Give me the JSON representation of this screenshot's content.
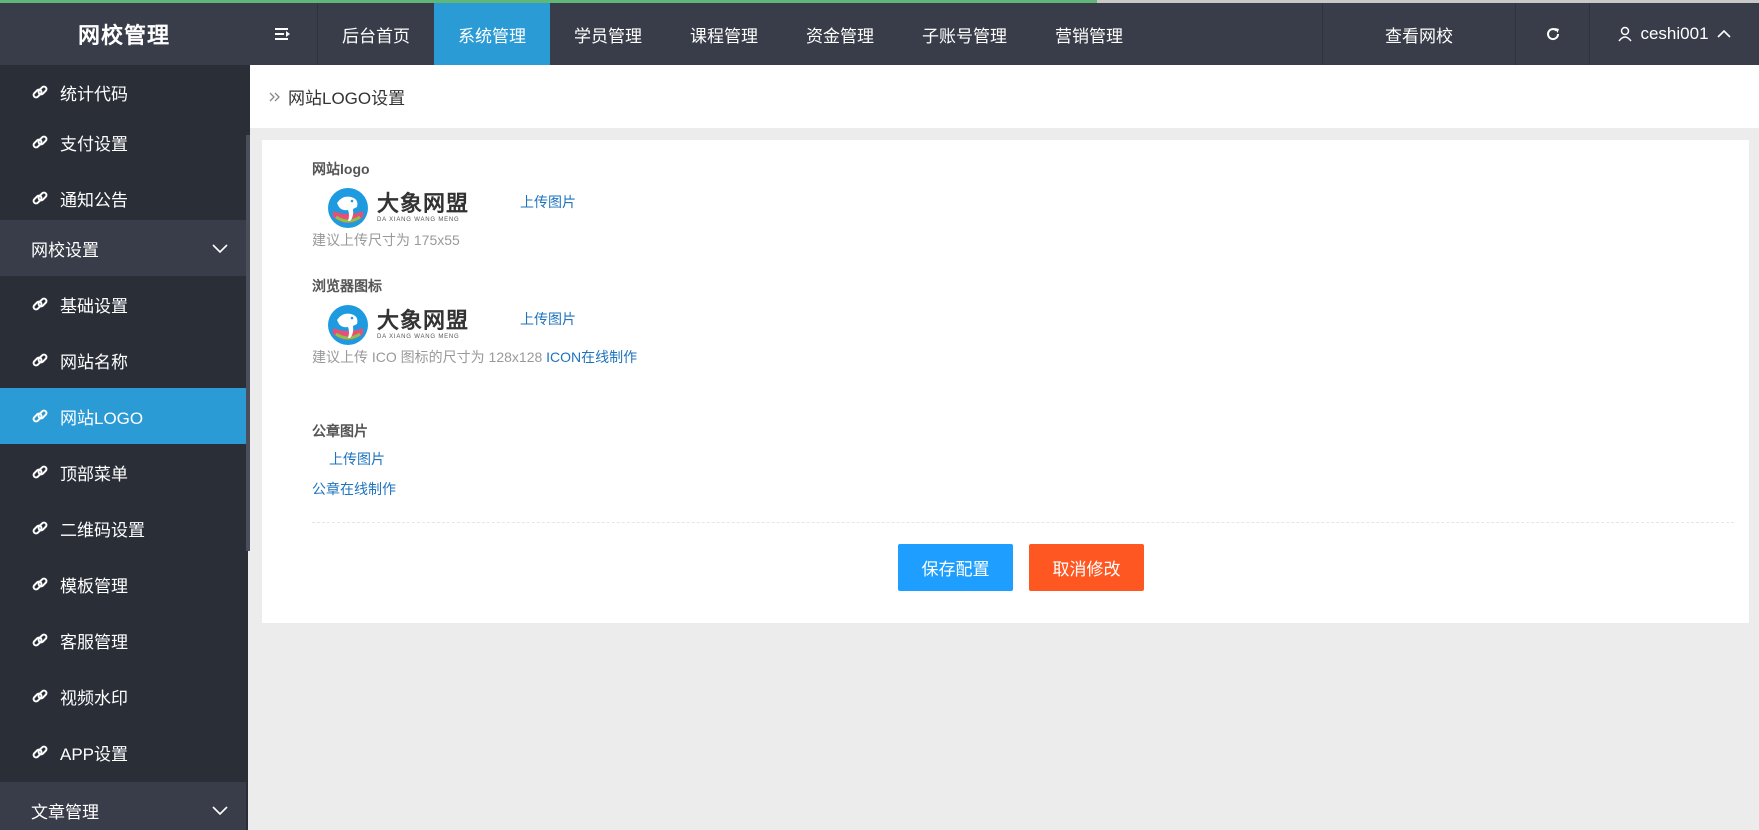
{
  "brand": {
    "title": "网校管理"
  },
  "topnav": {
    "items": [
      {
        "label": "后台首页",
        "active": false
      },
      {
        "label": "系统管理",
        "active": true
      },
      {
        "label": "学员管理",
        "active": false
      },
      {
        "label": "课程管理",
        "active": false
      },
      {
        "label": "资金管理",
        "active": false
      },
      {
        "label": "子账号管理",
        "active": false
      },
      {
        "label": "营销管理",
        "active": false
      }
    ],
    "view_site": "查看网校",
    "username": "ceshi001"
  },
  "sidebar": {
    "items": [
      {
        "label": "统计代码"
      },
      {
        "label": "支付设置"
      },
      {
        "label": "通知公告"
      }
    ],
    "group_school": "网校设置",
    "school_items": [
      {
        "label": "基础设置"
      },
      {
        "label": "网站名称"
      },
      {
        "label": "网站LOGO"
      },
      {
        "label": "顶部菜单"
      },
      {
        "label": "二维码设置"
      },
      {
        "label": "模板管理"
      },
      {
        "label": "客服管理"
      },
      {
        "label": "视频水印"
      },
      {
        "label": "APP设置"
      }
    ],
    "group_article": "文章管理"
  },
  "breadcrumb": {
    "current": "网站LOGO设置"
  },
  "form": {
    "logo": {
      "label": "网站logo",
      "brand_cn": "大象网盟",
      "brand_en": "DA XIANG WANG MENG",
      "upload": "上传图片",
      "hint": "建议上传尺寸为 175x55"
    },
    "favicon": {
      "label": "浏览器图标",
      "brand_cn": "大象网盟",
      "brand_en": "DA XIANG WANG MENG",
      "upload": "上传图片",
      "hint": "建议上传 ICO 图标的尺寸为 128x128",
      "hint_link": "ICON在线制作"
    },
    "seal": {
      "label": "公章图片",
      "upload": "上传图片",
      "make_link": "公章在线制作"
    },
    "save_button": "保存配置",
    "cancel_button": "取消修改"
  },
  "colors": {
    "topbar": "#393d49",
    "sidebar": "#2a2e37",
    "accent": "#2b9bd6",
    "save": "#1e9fff",
    "cancel": "#ff5722"
  }
}
